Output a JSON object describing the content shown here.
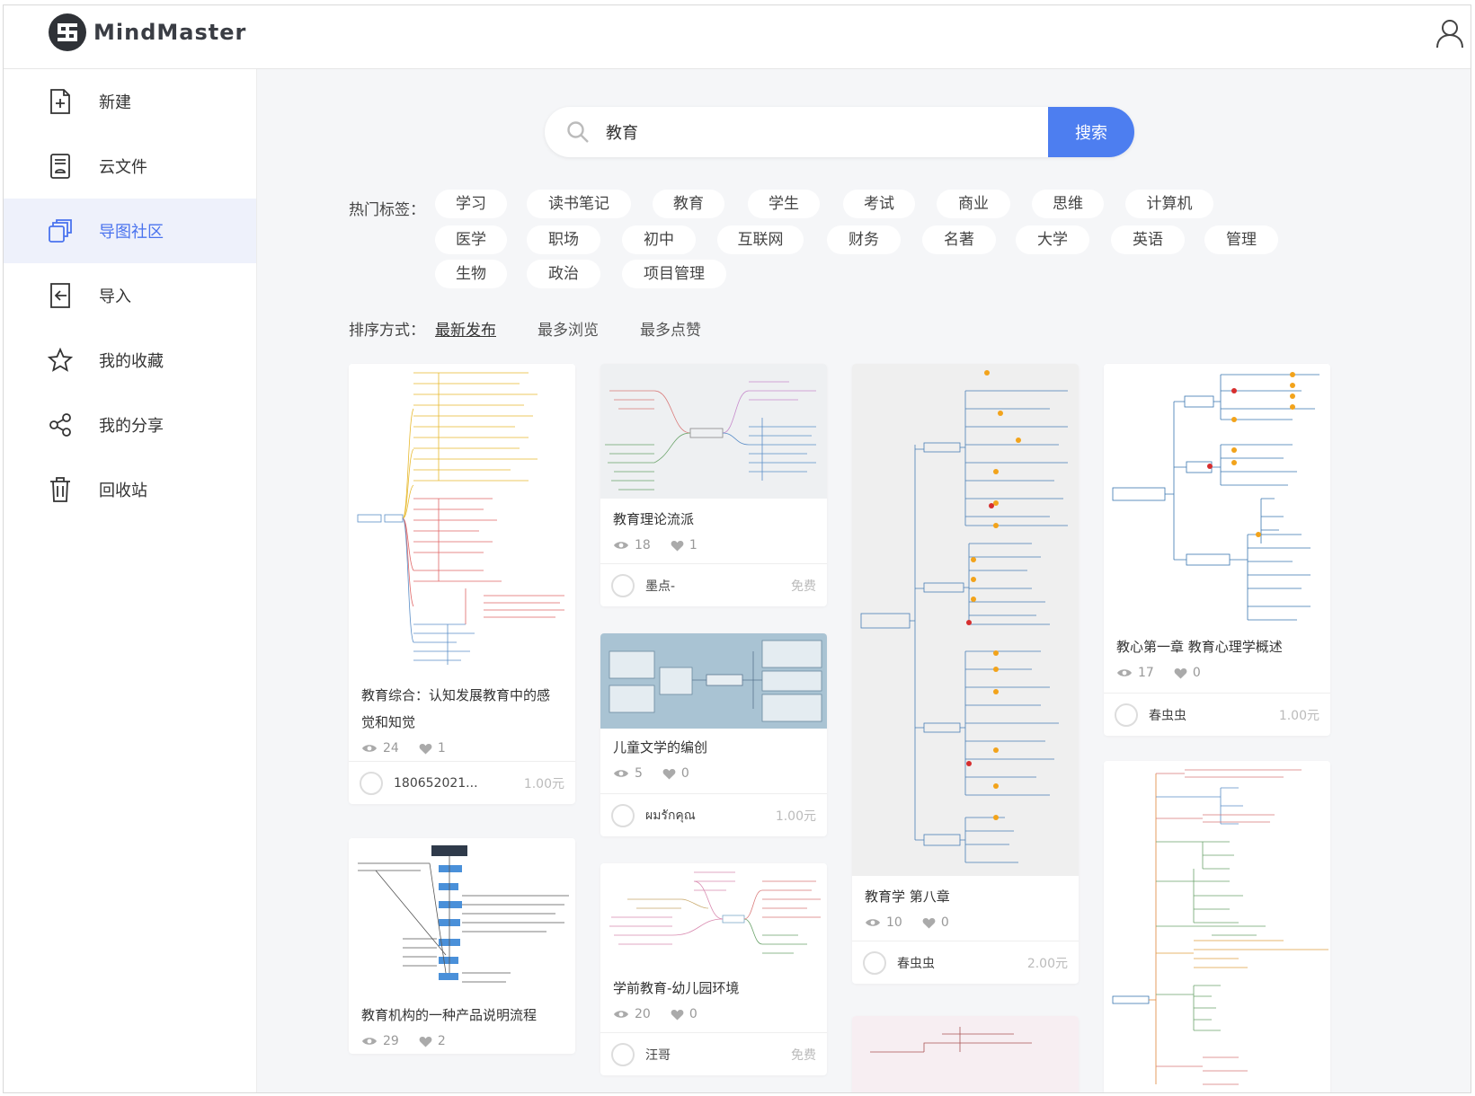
{
  "app": {
    "logo_text": "MindMaster"
  },
  "sidebar": {
    "items": [
      {
        "label": "新建",
        "icon": "file-add-icon"
      },
      {
        "label": "云文件",
        "icon": "cloud-file-icon"
      },
      {
        "label": "导图社区",
        "icon": "community-icon",
        "active": true
      },
      {
        "label": "导入",
        "icon": "import-icon"
      },
      {
        "label": "我的收藏",
        "icon": "star-icon"
      },
      {
        "label": "我的分享",
        "icon": "share-icon"
      },
      {
        "label": "回收站",
        "icon": "trash-icon"
      }
    ]
  },
  "search": {
    "value": "教育",
    "button_label": "搜索"
  },
  "tags": {
    "label": "热门标签：",
    "items": [
      "学习",
      "读书笔记",
      "教育",
      "学生",
      "考试",
      "商业",
      "思维",
      "计算机",
      "医学",
      "职场",
      "初中",
      "互联网",
      "财务",
      "名著",
      "大学",
      "英语",
      "管理",
      "生物",
      "政治",
      "项目管理"
    ]
  },
  "sort": {
    "label": "排序方式：",
    "options": [
      "最新发布",
      "最多浏览",
      "最多点赞"
    ],
    "active": "最新发布"
  },
  "cards": [
    {
      "title": "教育综合：认知发展教育中的感觉和知觉",
      "views": "24",
      "likes": "1",
      "author": "180652021...",
      "price": "1.00元"
    },
    {
      "title": "教育理论流派",
      "views": "18",
      "likes": "1",
      "author": "墨点-",
      "price": "免费"
    },
    {
      "title": "儿童文学的编创",
      "views": "5",
      "likes": "0",
      "author": "ผมรักคุณ",
      "price": "1.00元"
    },
    {
      "title": "教育学 第八章",
      "views": "10",
      "likes": "0",
      "author": "春虫虫",
      "price": "2.00元"
    },
    {
      "title": "教心第一章 教育心理学概述",
      "views": "17",
      "likes": "0",
      "author": "春虫虫",
      "price": "1.00元"
    },
    {
      "title": "教育机构的一种产品说明流程",
      "views": "29",
      "likes": "2",
      "author": "",
      "price": ""
    },
    {
      "title": "学前教育-幼儿园环境",
      "views": "20",
      "likes": "0",
      "author": "汪哥",
      "price": "免费"
    }
  ],
  "colors": {
    "accent": "#4d7ef0",
    "active_bg": "#eef1fb"
  }
}
